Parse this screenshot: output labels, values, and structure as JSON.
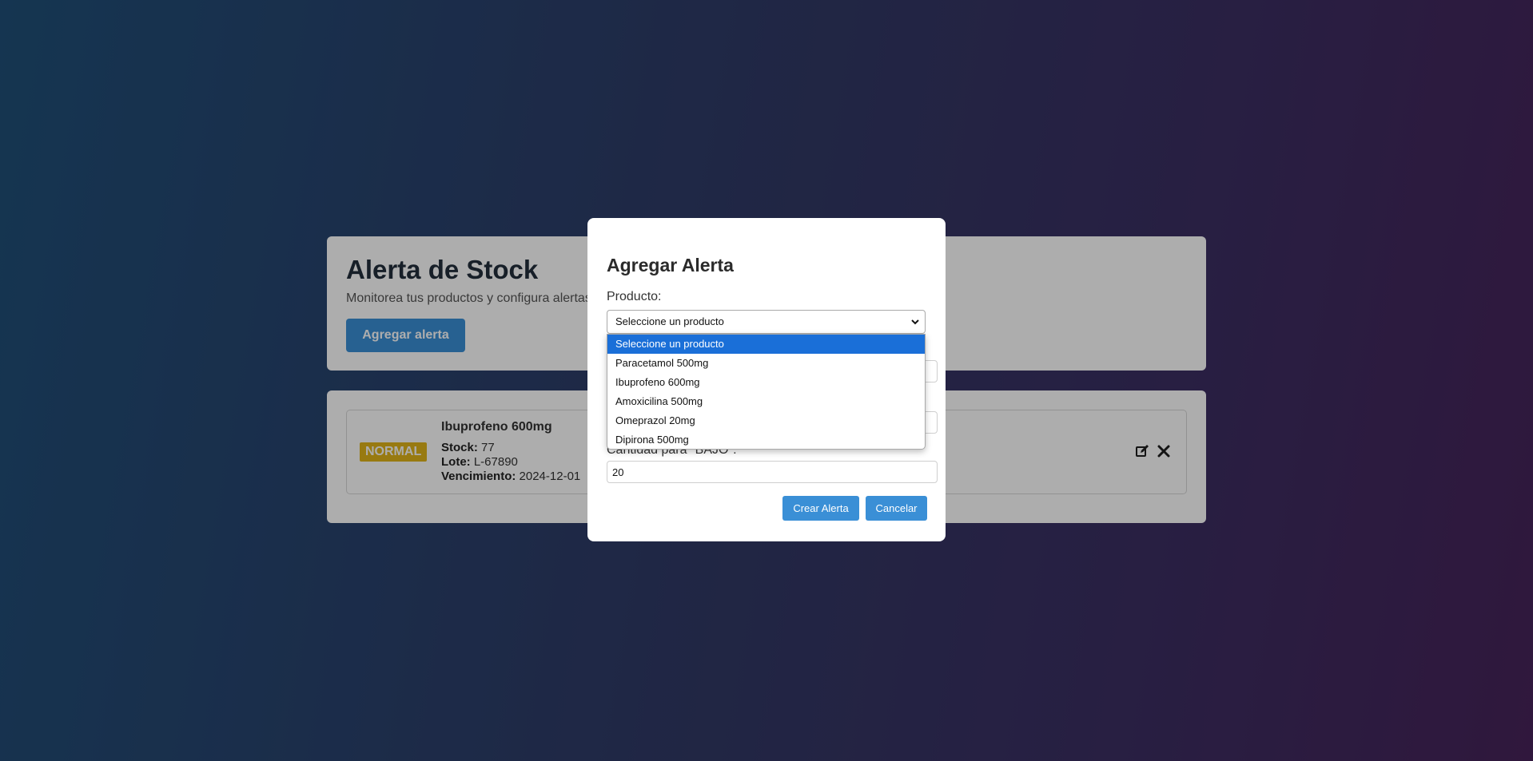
{
  "page": {
    "title": "Alerta de Stock",
    "subtitle": "Monitorea tus productos y configura alertas",
    "add_alert_label": "Agregar alerta"
  },
  "alert_item": {
    "status": "NORMAL",
    "status_color": "#e0b41a",
    "name": "Ibuprofeno 600mg",
    "stock_label": "Stock:",
    "stock_value": "77",
    "lote_label": "Lote:",
    "lote_value": "L-67890",
    "vencimiento_label": "Vencimiento:",
    "vencimiento_value": "2024-12-01",
    "actions": [
      "edit-icon",
      "close-icon"
    ]
  },
  "modal": {
    "title": "Agregar Alerta",
    "product_label": "Producto:",
    "product_selected": "Seleccione un producto",
    "low_quantity_label": "Cantidad para \"BAJO\":",
    "low_quantity_value": "20",
    "create_label": "Crear Alerta",
    "cancel_label": "Cancelar"
  },
  "dropdown": {
    "options": [
      "Seleccione un producto",
      "Paracetamol 500mg",
      "Ibuprofeno 600mg",
      "Amoxicilina 500mg",
      "Omeprazol 20mg",
      "Dipirona 500mg"
    ],
    "selected_index": 0
  },
  "colors": {
    "accent": "#3a8fd6",
    "dropdown_highlight": "#1a6fd8"
  }
}
